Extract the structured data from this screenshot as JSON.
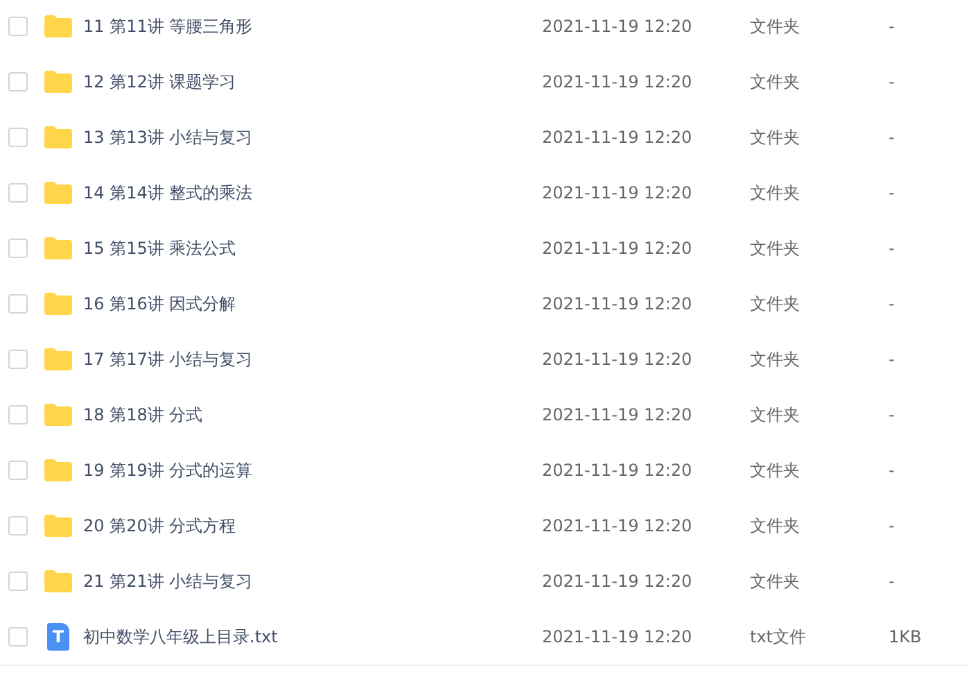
{
  "files": [
    {
      "kind": "folder",
      "name": "11 第11讲 等腰三角形",
      "modified": "2021-11-19 12:20",
      "type": "文件夹",
      "size": "-",
      "checked": false
    },
    {
      "kind": "folder",
      "name": "12 第12讲 课题学习",
      "modified": "2021-11-19 12:20",
      "type": "文件夹",
      "size": "-",
      "checked": false
    },
    {
      "kind": "folder",
      "name": "13 第13讲 小结与复习",
      "modified": "2021-11-19 12:20",
      "type": "文件夹",
      "size": "-",
      "checked": false
    },
    {
      "kind": "folder",
      "name": "14 第14讲 整式的乘法",
      "modified": "2021-11-19 12:20",
      "type": "文件夹",
      "size": "-",
      "checked": false
    },
    {
      "kind": "folder",
      "name": "15 第15讲 乘法公式",
      "modified": "2021-11-19 12:20",
      "type": "文件夹",
      "size": "-",
      "checked": false
    },
    {
      "kind": "folder",
      "name": "16 第16讲 因式分解",
      "modified": "2021-11-19 12:20",
      "type": "文件夹",
      "size": "-",
      "checked": false
    },
    {
      "kind": "folder",
      "name": "17 第17讲 小结与复习",
      "modified": "2021-11-19 12:20",
      "type": "文件夹",
      "size": "-",
      "checked": false
    },
    {
      "kind": "folder",
      "name": "18 第18讲 分式",
      "modified": "2021-11-19 12:20",
      "type": "文件夹",
      "size": "-",
      "checked": false
    },
    {
      "kind": "folder",
      "name": "19 第19讲 分式的运算",
      "modified": "2021-11-19 12:20",
      "type": "文件夹",
      "size": "-",
      "checked": false
    },
    {
      "kind": "folder",
      "name": "20 第20讲 分式方程",
      "modified": "2021-11-19 12:20",
      "type": "文件夹",
      "size": "-",
      "checked": false
    },
    {
      "kind": "folder",
      "name": "21 第21讲 小结与复习",
      "modified": "2021-11-19 12:20",
      "type": "文件夹",
      "size": "-",
      "checked": false
    },
    {
      "kind": "text",
      "icon_letter": "T",
      "name": "初中数学八年级上目录.txt",
      "modified": "2021-11-19 12:20",
      "type": "txt文件",
      "size": "1KB",
      "checked": false
    }
  ]
}
